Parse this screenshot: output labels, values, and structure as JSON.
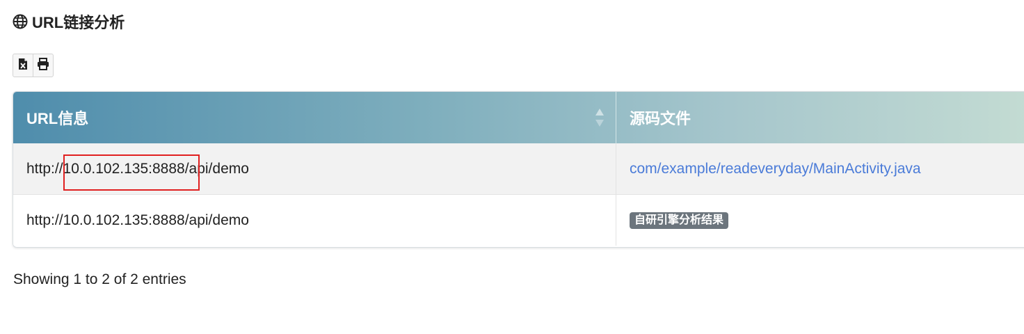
{
  "section": {
    "title": "URL链接分析",
    "icon": "globe-icon"
  },
  "toolbar": {
    "excel_icon": "file-excel-icon",
    "print_icon": "print-icon"
  },
  "table": {
    "columns": [
      "URL信息",
      "源码文件"
    ],
    "rows": [
      {
        "url": "http://10.0.102.135:8888/api/demo",
        "source": "com/example/readeveryday/MainActivity.java",
        "source_type": "link"
      },
      {
        "url": "http://10.0.102.135:8888/api/demo",
        "source": "自研引擎分析结果",
        "source_type": "badge"
      }
    ],
    "highlight_color": "#e02020",
    "link_color": "#4a7bd8",
    "badge_color": "#6c757d"
  },
  "footer": {
    "info": "Showing 1 to 2 of 2 entries"
  }
}
